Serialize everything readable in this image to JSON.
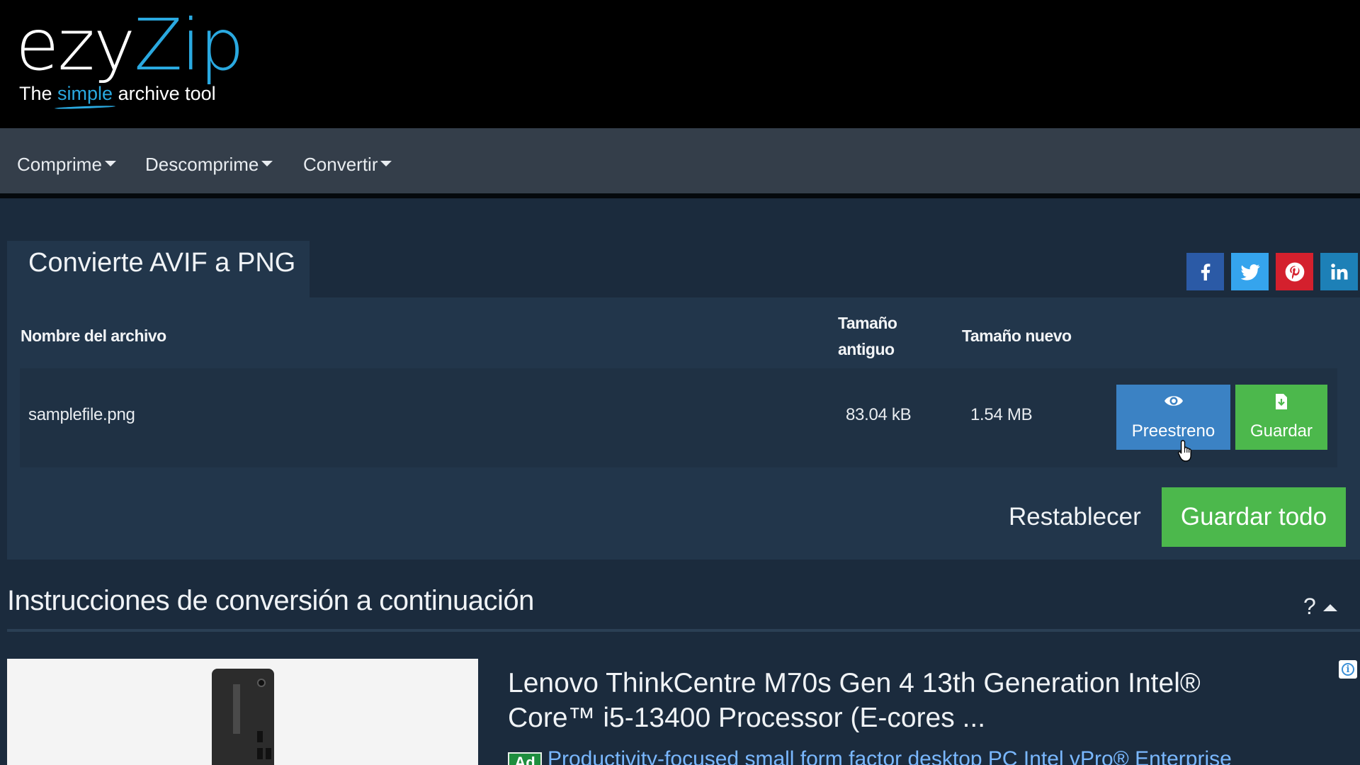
{
  "logo": {
    "ezy": "ezy",
    "zip": "Zip",
    "tagline_before": "The ",
    "tagline_highlight": "simple",
    "tagline_after": " archive tool"
  },
  "nav": {
    "items": [
      {
        "label": "Comprime"
      },
      {
        "label": "Descomprime"
      },
      {
        "label": "Convertir"
      }
    ]
  },
  "tab": {
    "title": "Convierte AVIF a PNG"
  },
  "social": {
    "facebook_color": "#2b5aa6",
    "twitter_color": "#35a4ed",
    "pinterest_color": "#d4202d",
    "linkedin_color": "#1d80b7"
  },
  "table": {
    "headers": {
      "filename": "Nombre del archivo",
      "old_size_line1": "Tamaño",
      "old_size_line2": "antiguo",
      "new_size": "Tamaño nuevo"
    },
    "rows": [
      {
        "filename": "samplefile.png",
        "old_size": "83.04 kB",
        "new_size": "1.54 MB",
        "preview_label": "Preestreno",
        "save_label": "Guardar"
      }
    ]
  },
  "actions": {
    "reset_label": "Restablecer",
    "save_all_label": "Guardar todo"
  },
  "instructions": {
    "title": "Instrucciones de conversión a continuación",
    "help": "?"
  },
  "ad": {
    "title_line1": "Lenovo ThinkCentre M70s Gen 4 13th Generation Intel®",
    "title_line2": "Core™ i5-13400 Processor (E-cores ...",
    "badge": "Ad",
    "description": "Productivity-focused small form factor desktop PC Intel vPro® Enterprise",
    "product_label": "ThinkCentre"
  },
  "colors": {
    "accent_blue": "#2aa9e0",
    "button_blue": "#3b82c4",
    "button_green": "#4cb84c"
  }
}
